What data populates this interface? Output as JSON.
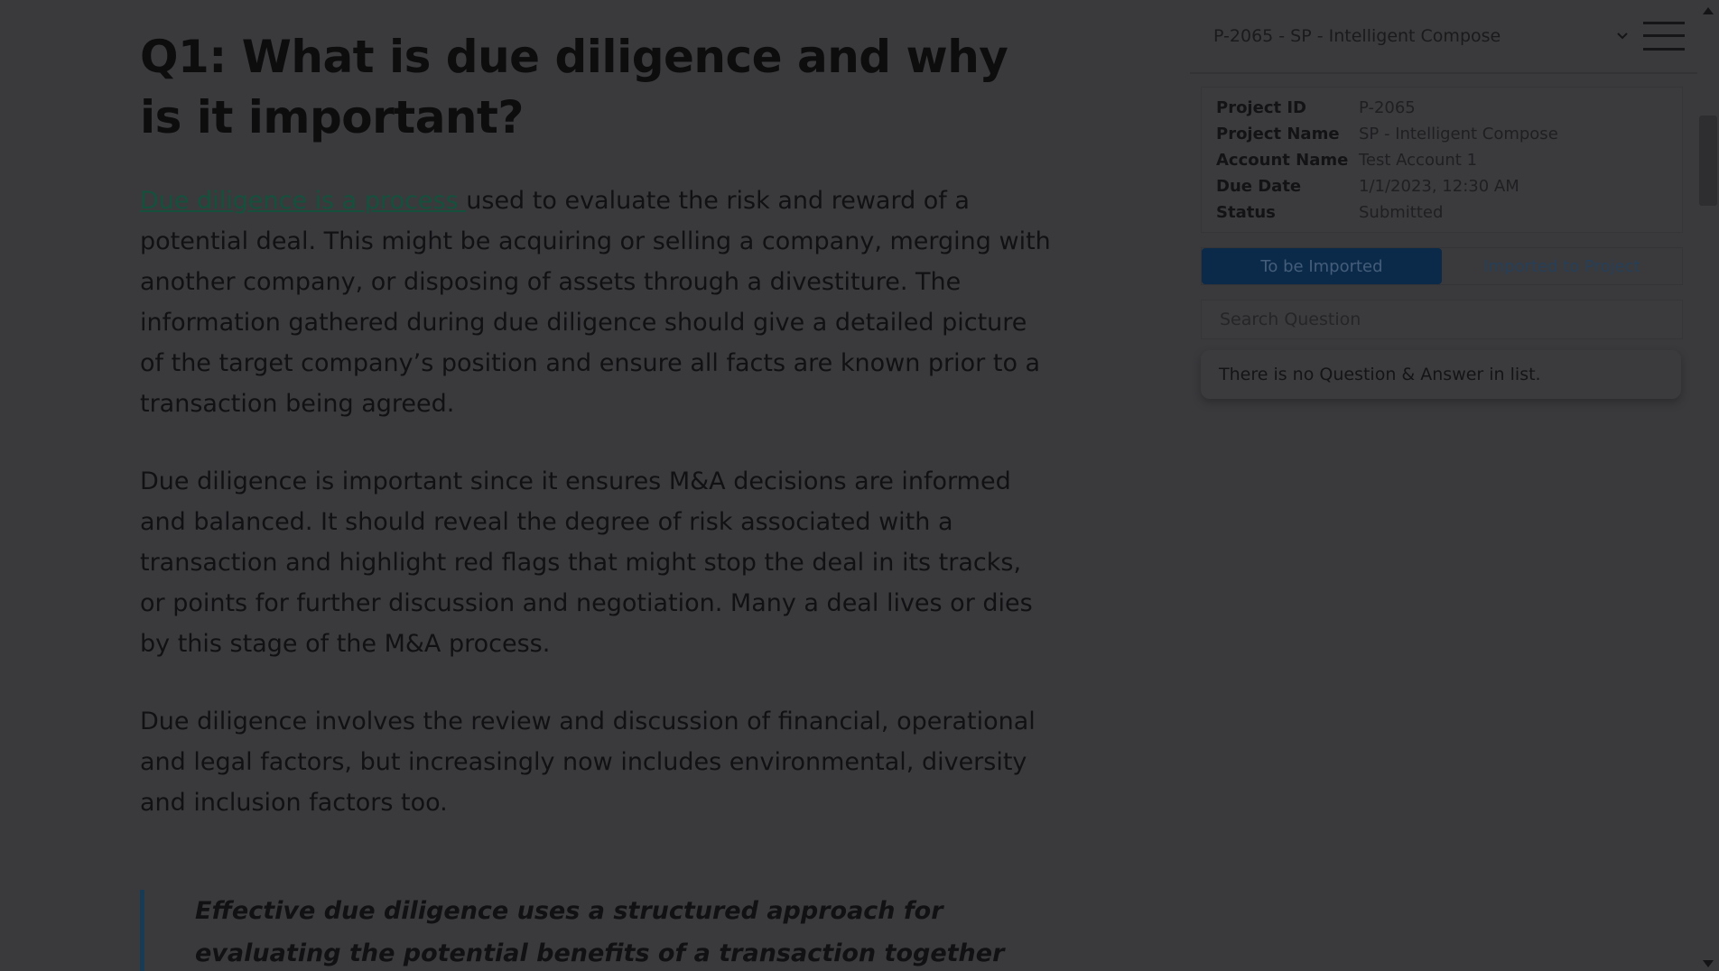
{
  "document": {
    "title": "Q1: What is due diligence and why is it important?",
    "p1_link": "Due diligence is a process ",
    "p1_rest": "used to evaluate the risk and reward of a potential deal. This might be acquiring or selling a company, merging with another company, or disposing of assets through a divestiture. The information gathered during due diligence should give a detailed picture of the target company’s position and ensure all facts are known prior to a transaction being agreed.",
    "p2": "Due diligence is important since it ensures M&A decisions are informed and balanced. It should reveal the degree of risk associated with a transaction and highlight red flags that might stop the deal in its tracks, or points for further discussion and negotiation. Many a deal lives or dies by this stage of the M&A process.",
    "p3": "Due diligence involves the review and discussion of financial, operational and legal factors, but increasingly now includes environmental, diversity and inclusion factors too.",
    "quote": "Effective due diligence uses a structured approach for evaluating the potential benefits of a transaction together with any associated risks that"
  },
  "panel": {
    "project_select": "P-2065 - SP - Intelligent Compose",
    "info": [
      {
        "key": "Project ID",
        "value": "P-2065"
      },
      {
        "key": "Project Name",
        "value": "SP - Intelligent Compose"
      },
      {
        "key": "Account Name",
        "value": "Test Account 1"
      },
      {
        "key": "Due Date",
        "value": "1/1/2023, 12:30 AM"
      },
      {
        "key": "Status",
        "value": "Submitted"
      }
    ],
    "tabs": [
      {
        "label": "To be Imported",
        "active": true
      },
      {
        "label": "Imported to Project",
        "active": false
      }
    ],
    "search_placeholder": "Search Question",
    "empty_message": "There is no Question & Answer in list."
  },
  "icons": {
    "dropdown": "chevron-down-icon",
    "menu": "hamburger-menu-icon",
    "scroll_up": "scroll-up-arrow-icon",
    "scroll_down": "scroll-down-arrow-icon"
  },
  "colors": {
    "overlay_background": "#3a3a3d",
    "active_tab": "#0b2a4a",
    "link": "#15503c",
    "quote_border": "#173a55"
  }
}
